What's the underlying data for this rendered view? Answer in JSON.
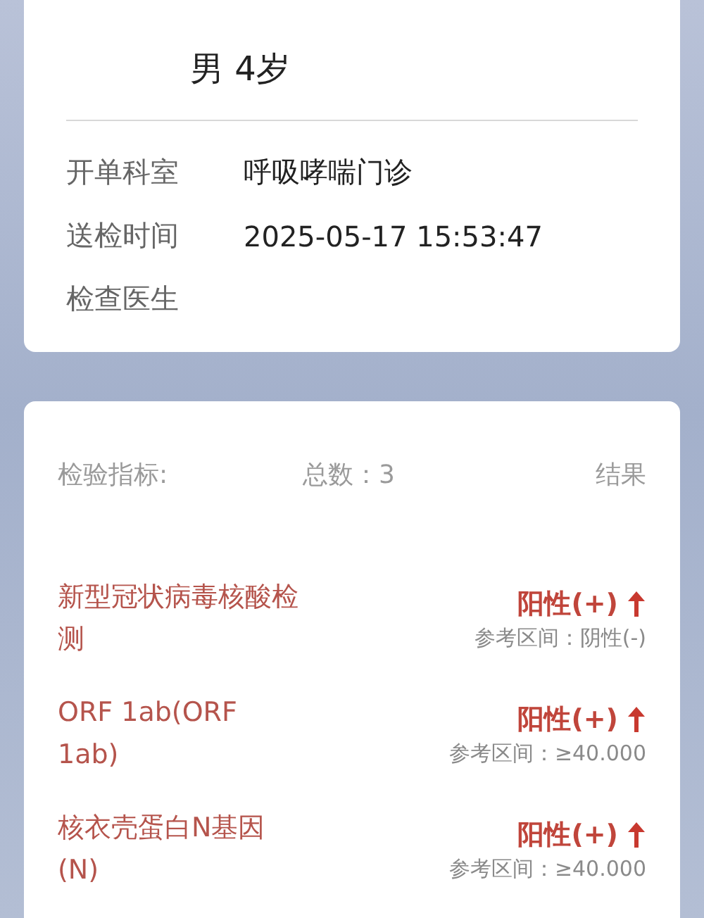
{
  "patient": {
    "summary": "男 4岁"
  },
  "info": [
    {
      "label": "开单科室",
      "value": "呼吸哮喘门诊"
    },
    {
      "label": "送检时间",
      "value": "2025-05-17 15:53:47"
    },
    {
      "label": "检查医生"
    }
  ],
  "results": {
    "header": {
      "indicator": "检验指标:",
      "total": "总数：3",
      "result": "结果"
    },
    "items": [
      {
        "name": "新型冠状病毒核酸检测",
        "result": "阳性(+)",
        "elevated": true,
        "reference": "参考区间：阴性(-)"
      },
      {
        "name": "ORF 1ab(ORF 1ab)",
        "result": "阳性(+)",
        "elevated": true,
        "reference": "参考区间：≥40.000"
      },
      {
        "name": "核衣壳蛋白N基因(N)",
        "result": "阳性(+)",
        "elevated": true,
        "reference": "参考区间：≥40.000"
      }
    ]
  }
}
